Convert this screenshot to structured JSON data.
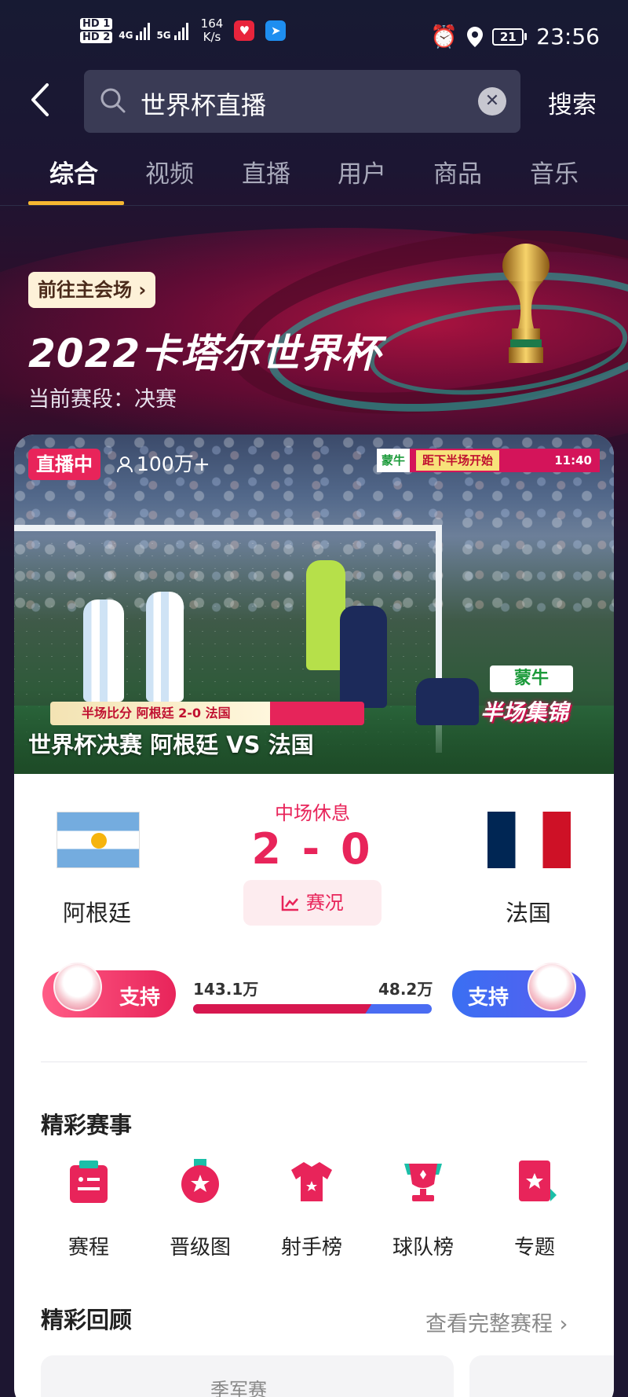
{
  "status_bar": {
    "hd1": "HD 1",
    "hd2": "HD 2",
    "net1": "4G",
    "net2": "5G",
    "speed_value": "164",
    "speed_unit": "K/s",
    "battery": "21",
    "time": "23:56"
  },
  "search": {
    "query": "世界杯直播",
    "button": "搜索"
  },
  "tabs": [
    "综合",
    "视频",
    "直播",
    "用户",
    "商品",
    "音乐"
  ],
  "banner": {
    "goto_label": "前往主会场",
    "title": "2022卡塔尔世界杯",
    "stage": "当前赛段：决赛"
  },
  "live": {
    "badge": "直播中",
    "viewers": "100万+",
    "ad_brand": "蒙牛",
    "ad_countdown": "距下半场开始",
    "ad_time": "11:40",
    "score_ribbon": "半场比分  阿根廷 2-0 法国",
    "highlight_brand": "蒙牛",
    "highlight_text": "半场集锦",
    "title": "世界杯决赛 阿根廷 VS 法国"
  },
  "match": {
    "home": "阿根廷",
    "away": "法国",
    "status": "中场休息",
    "score": "2 - 0",
    "stats_label": "赛况"
  },
  "support": {
    "left_label": "支持",
    "right_label": "支持",
    "left_votes": "143.1万",
    "right_votes": "48.2万",
    "left_share": 0.748
  },
  "highlights_section": {
    "title": "精彩赛事",
    "items": [
      "赛程",
      "晋级图",
      "射手榜",
      "球队榜",
      "专题"
    ]
  },
  "recap_section": {
    "title": "精彩回顾",
    "more": "查看完整赛程",
    "first_card": "季军赛"
  },
  "colors": {
    "accent": "#e8245a",
    "tab_underline": "#f5b731",
    "support_blue": "#4a6cf2"
  }
}
